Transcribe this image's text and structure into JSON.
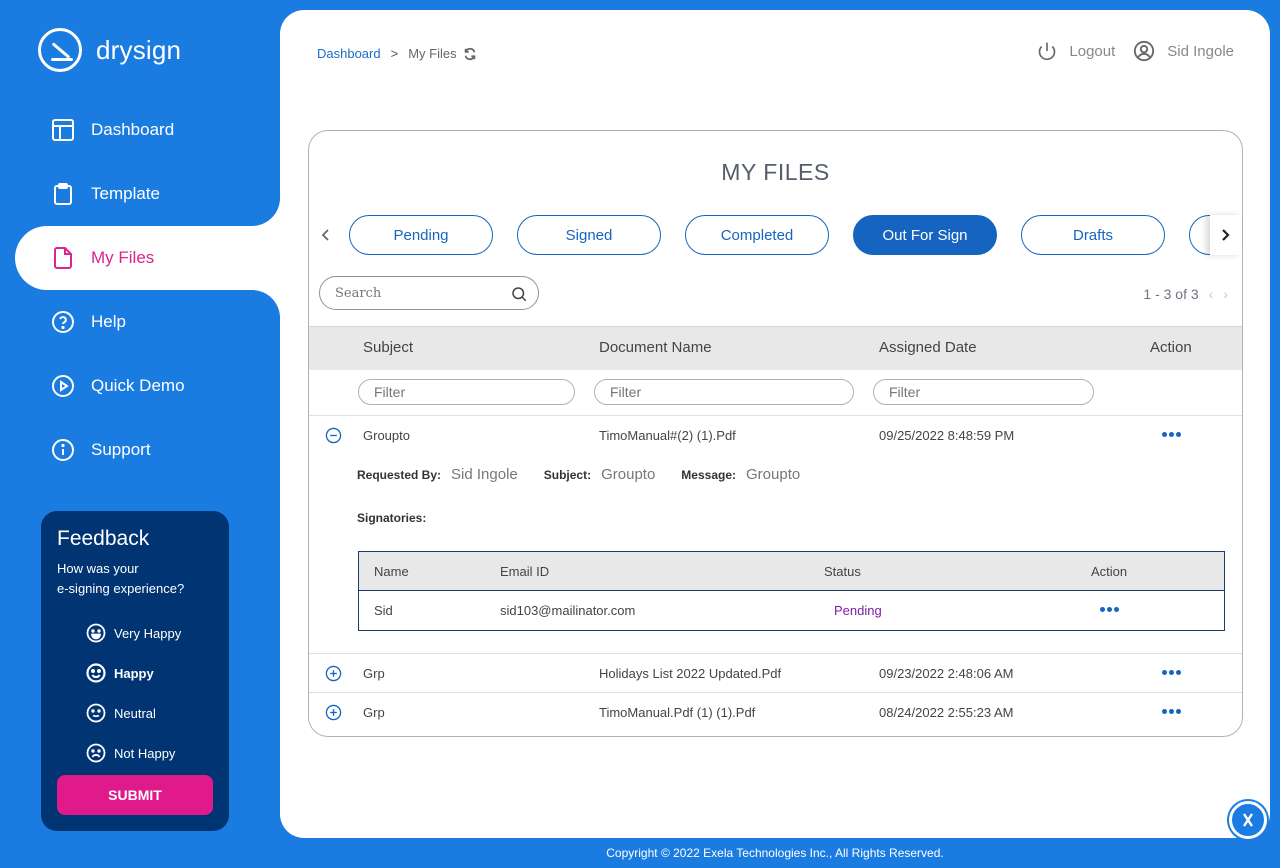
{
  "brand": {
    "name": "drysign"
  },
  "sidebar": {
    "items": [
      {
        "label": "Dashboard",
        "icon": "layout-icon"
      },
      {
        "label": "Template",
        "icon": "clipboard-icon"
      },
      {
        "label": "My Files",
        "icon": "file-icon",
        "active": true
      },
      {
        "label": "Help",
        "icon": "help-circle-icon"
      },
      {
        "label": "Quick Demo",
        "icon": "play-circle-icon"
      },
      {
        "label": "Support",
        "icon": "info-circle-icon"
      }
    ]
  },
  "feedback": {
    "title": "Feedback",
    "question_line1": "How was your",
    "question_line2": "e-signing experience?",
    "options": [
      {
        "label": "Very Happy",
        "icon": "very-happy-face-icon"
      },
      {
        "label": "Happy",
        "icon": "happy-face-icon",
        "selected": true
      },
      {
        "label": "Neutral",
        "icon": "neutral-face-icon"
      },
      {
        "label": "Not Happy",
        "icon": "sad-face-icon"
      }
    ],
    "submit_label": "SUBMIT"
  },
  "header": {
    "breadcrumb": {
      "root": "Dashboard",
      "separator": ">",
      "current": "My Files"
    },
    "logout_label": "Logout",
    "user_name": "Sid Ingole"
  },
  "files": {
    "title": "MY FILES",
    "tabs": [
      {
        "label": "Pending"
      },
      {
        "label": "Signed"
      },
      {
        "label": "Completed"
      },
      {
        "label": "Out For Sign",
        "active": true
      },
      {
        "label": "Drafts"
      },
      {
        "label": ""
      }
    ],
    "search_placeholder": "Search",
    "pager_text": "1 - 3 of 3",
    "columns": {
      "subject": "Subject",
      "document": "Document Name",
      "date": "Assigned Date",
      "action": "Action"
    },
    "filter_placeholder": "Filter",
    "rows": [
      {
        "subject": "Groupto",
        "document": "TimoManual#(2) (1).Pdf",
        "date": "09/25/2022 8:48:59 PM",
        "expanded": true
      },
      {
        "subject": "Grp",
        "document": "Holidays List 2022 Updated.Pdf",
        "date": "09/23/2022 2:48:06 AM",
        "expanded": false
      },
      {
        "subject": "Grp",
        "document": "TimoManual.Pdf (1) (1).Pdf",
        "date": "08/24/2022 2:55:23 AM",
        "expanded": false
      }
    ],
    "details": {
      "requested_by_label": "Requested By:",
      "requested_by": "Sid Ingole",
      "subject_label": "Subject:",
      "subject": "Groupto",
      "message_label": "Message:",
      "message": "Groupto",
      "signatories_label": "Signatories:",
      "signatory_columns": {
        "name": "Name",
        "email": "Email ID",
        "status": "Status",
        "action": "Action"
      },
      "signatories": [
        {
          "name": "Sid",
          "email": "sid103@mailinator.com",
          "status": "Pending"
        }
      ]
    }
  },
  "footer": {
    "copyright": "Copyright © 2022 Exela Technologies Inc., All Rights Reserved."
  },
  "colors": {
    "brand_blue": "#1a7ce0",
    "tab_blue": "#1565c0",
    "accent_pink": "#e11a8c",
    "feedback_bg": "#003472",
    "pending_purple": "#7b1fa2"
  }
}
